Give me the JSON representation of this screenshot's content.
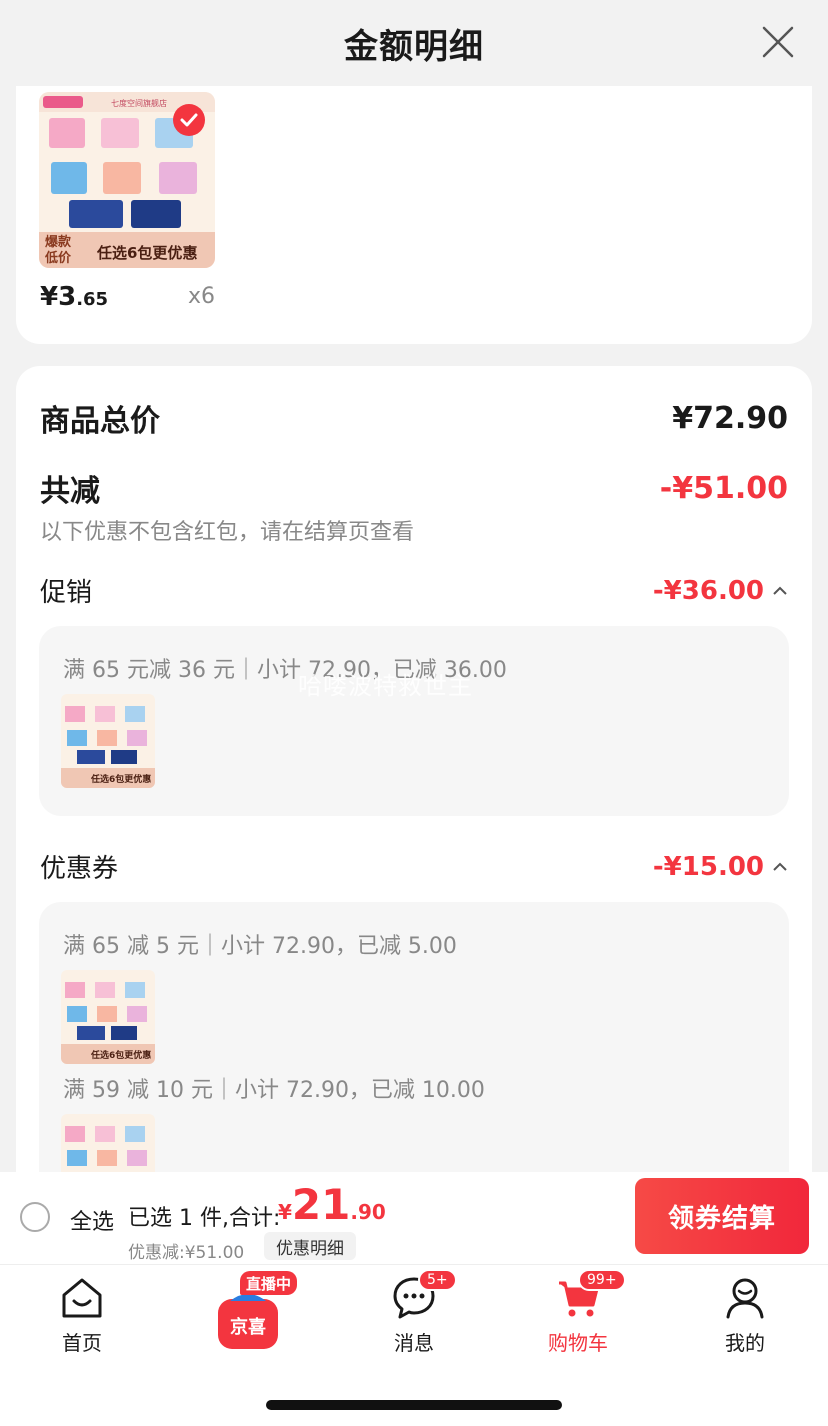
{
  "header": {
    "title": "金额明细"
  },
  "product": {
    "store_name": "七度空间旗舰店",
    "img_tag_left": "爆款\n低价",
    "img_tag_right": "任选6包更优惠",
    "price_int": "¥3",
    "price_dec": ".65",
    "qty": "x6"
  },
  "summary": {
    "total_label": "商品总价",
    "total_value": "¥72.90",
    "reduce_label": "共减",
    "reduce_value": "-¥51.00",
    "note": "以下优惠不包含红包，请在结算页查看"
  },
  "promotion": {
    "label": "促销",
    "value": "-¥36.00",
    "line": "满 65 元减 36 元｜小计 72.90，已减 36.00"
  },
  "coupon": {
    "label": "优惠券",
    "value": "-¥15.00",
    "line1": "满 65 减 5 元｜小计 72.90，已减 5.00",
    "line2": "满 59 减 10 元｜小计 72.90，已减 10.00"
  },
  "watermark": "哈喽波特救世主",
  "bottom_bar": {
    "select_all": "全选",
    "selected_text": "已选 1 件,合计:",
    "price_yen": "¥",
    "price_int": "21",
    "price_dec": ".90",
    "discount_text": "优惠减:¥51.00",
    "detail_chip": "优惠明细",
    "checkout": "领券结算"
  },
  "tabbar": {
    "home": "首页",
    "live_tag": "直播中",
    "jx_logo": "京喜",
    "messages": "消息",
    "messages_badge": "5+",
    "cart": "购物车",
    "cart_badge": "99+",
    "mine": "我的"
  },
  "colors": {
    "accent": "#f3353f",
    "muted": "#888888",
    "background": "#f2f2f2"
  }
}
